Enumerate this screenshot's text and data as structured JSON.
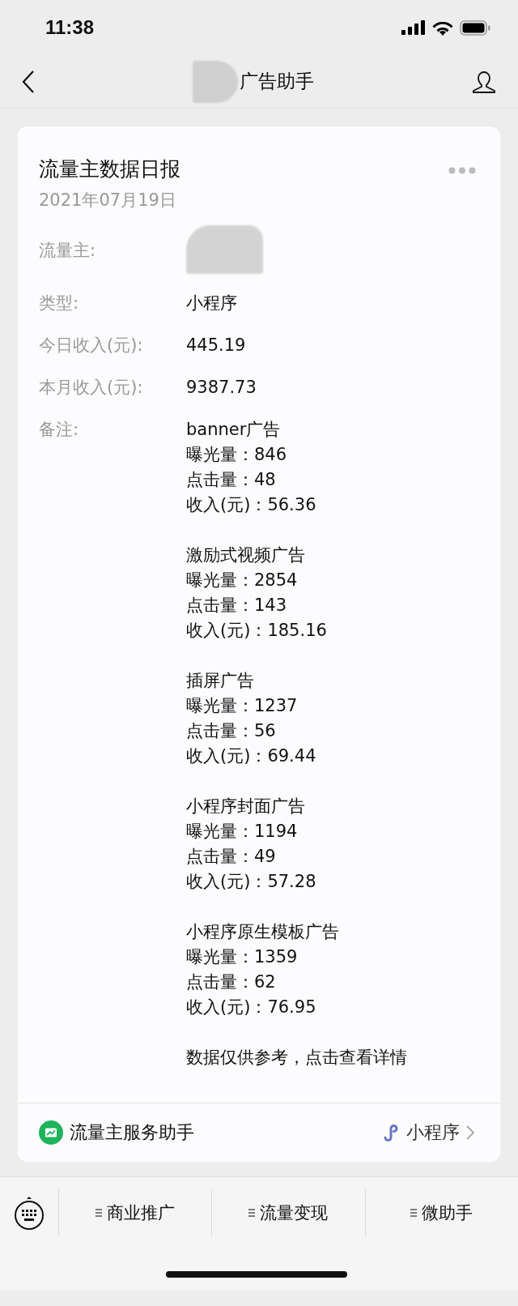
{
  "status_bar": {
    "time": "11:38"
  },
  "nav": {
    "title": "广告助手"
  },
  "card": {
    "title": "流量主数据日报",
    "date": "2021年07月19日",
    "fields": [
      {
        "label": "流量主:",
        "kind": "redacted"
      },
      {
        "label": "类型:",
        "kind": "text",
        "value": "小程序"
      },
      {
        "label": "今日收入(元):",
        "kind": "text",
        "value": "445.19"
      },
      {
        "label": "本月收入(元):",
        "kind": "text",
        "value": "9387.73"
      }
    ],
    "remarks": {
      "label": "备注:",
      "groups": [
        {
          "lines": [
            "banner广告",
            "曝光量：846",
            "点击量：48",
            "收入(元)：56.36"
          ]
        },
        {
          "lines": [
            "激励式视频广告",
            "曝光量：2854",
            "点击量：143",
            "收入(元)：185.16"
          ]
        },
        {
          "lines": [
            "插屏广告",
            "曝光量：1237",
            "点击量：56",
            "收入(元)：69.44"
          ]
        },
        {
          "lines": [
            "小程序封面广告",
            "曝光量：1194",
            "点击量：49",
            "收入(元)：57.28"
          ]
        },
        {
          "lines": [
            "小程序原生模板广告",
            "曝光量：1359",
            "点击量：62",
            "收入(元)：76.95"
          ]
        }
      ],
      "note": "数据仅供参考，点击查看详情"
    },
    "footer": {
      "source": "流量主服务助手",
      "link": "小程序"
    }
  },
  "menu": {
    "items": [
      "商业推广",
      "流量变现",
      "微助手"
    ]
  }
}
